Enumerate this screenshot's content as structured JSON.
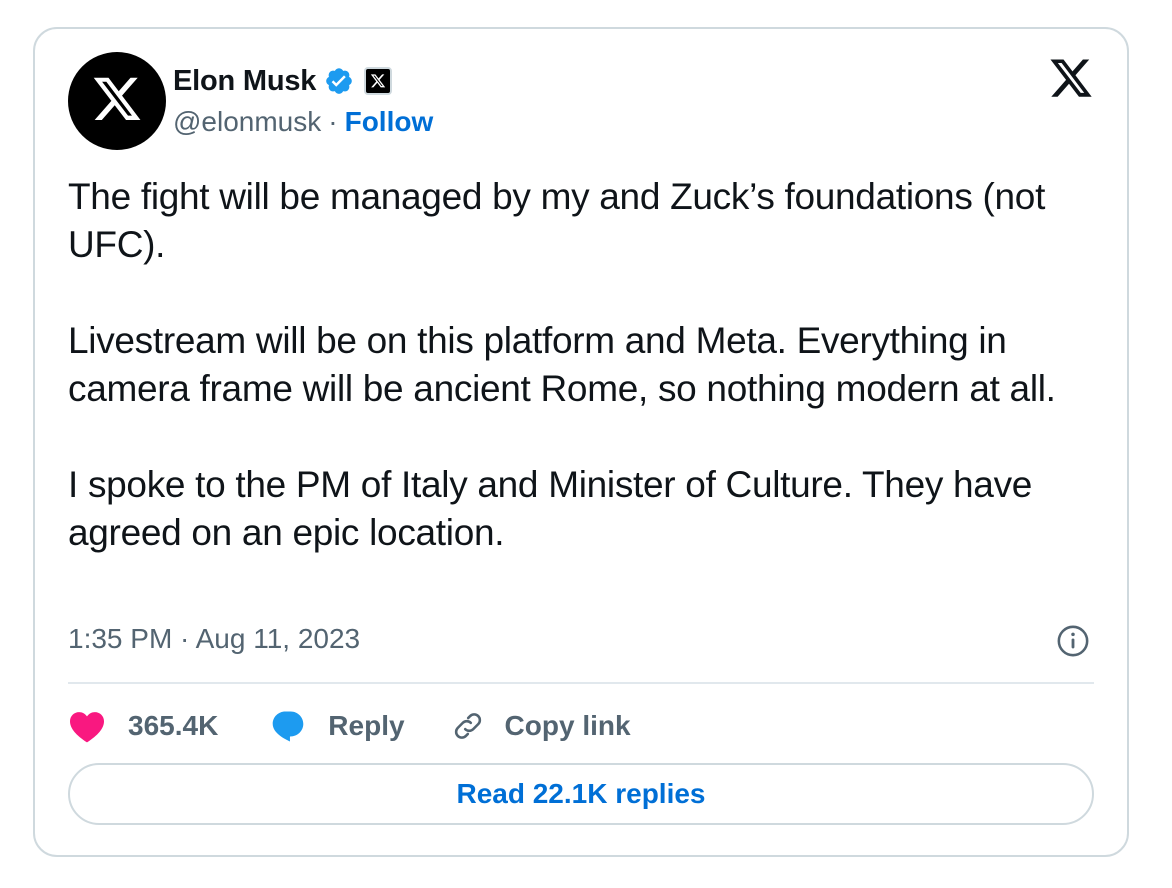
{
  "author": {
    "name": "Elon Musk",
    "handle": "@elonmusk",
    "separator": "·",
    "follow_label": "Follow",
    "avatar_icon": "x-logo-icon",
    "verified_color": "#1d9bf0"
  },
  "tweet": {
    "paragraphs": [
      "The fight will be managed by my and Zuck’s foundations (not UFC).",
      "Livestream will be on this platform and Meta. Everything in camera frame will be ancient Rome, so nothing modern at all.",
      "I spoke to the PM of Italy and Minister of Culture. They have agreed on an epic location."
    ],
    "timestamp": "1:35 PM · Aug 11, 2023"
  },
  "actions": {
    "like_count": "365.4K",
    "like_icon": "heart-icon",
    "like_color": "#f91880",
    "reply_label": "Reply",
    "reply_icon": "speech-bubble-icon",
    "reply_color": "#1d9bf0",
    "copy_label": "Copy link",
    "copy_icon": "link-icon"
  },
  "footer": {
    "read_replies_label": "Read 22.1K replies"
  },
  "colors": {
    "text": "#0f1419",
    "muted": "#536471",
    "link": "#006fd6",
    "border": "#cfd9de"
  }
}
